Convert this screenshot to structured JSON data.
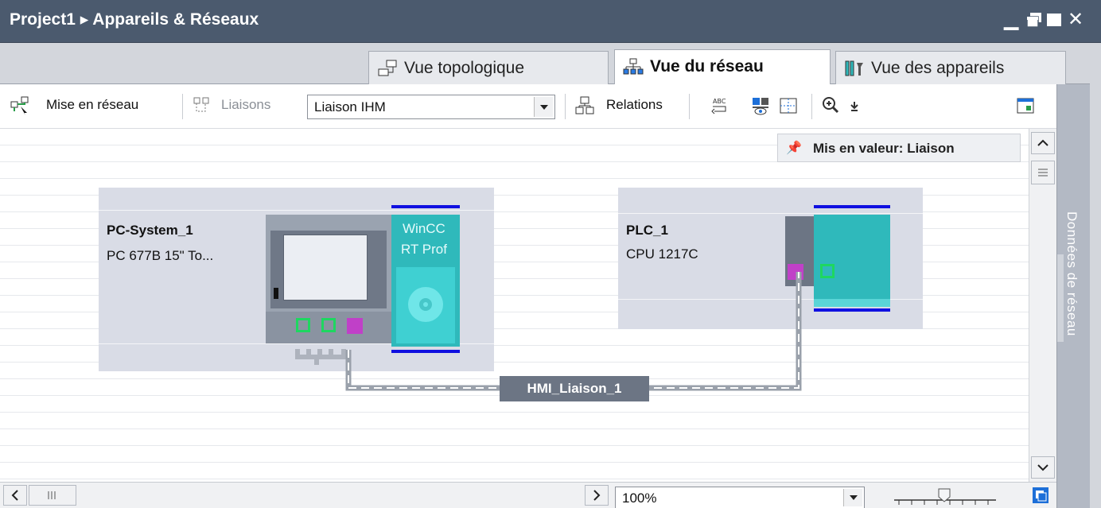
{
  "window": {
    "title": "Project1  ▸  Appareils & Réseaux",
    "controls": [
      "minimize-icon",
      "restore-icon",
      "maximize-icon",
      "close-icon"
    ]
  },
  "tabs": [
    {
      "label": "Vue topologique",
      "icon": "topology-icon",
      "active": false
    },
    {
      "label": "Vue du réseau",
      "icon": "network-icon",
      "active": true
    },
    {
      "label": "Vue des appareils",
      "icon": "devices-icon",
      "active": false
    }
  ],
  "toolbar": {
    "networking_label": "Mise en réseau",
    "connections_label": "Liaisons",
    "connection_type_value": "Liaison IHM",
    "relations_label": "Relations"
  },
  "tooltip": {
    "text": "Mis en valeur: Liaison"
  },
  "devices": [
    {
      "name": "PC-System_1",
      "type": "PC 677B 15\" To...",
      "module_label_1": "WinCC",
      "module_label_2": "RT Prof"
    },
    {
      "name": "PLC_1",
      "type": "CPU 1217C"
    }
  ],
  "connection": {
    "label": "HMI_Liaison_1"
  },
  "side_panel": {
    "label": "Données de réseau"
  },
  "zoom": {
    "value": "100%"
  },
  "colors": {
    "titlebar": "#4b5a6e",
    "device_bg": "#d9dce6",
    "cpu_teal": "#2fb9bb",
    "profinet_magenta": "#c040c8",
    "port_green": "#1ed760",
    "blue_rail": "#1010e0",
    "connection_label_bg": "#6c7584"
  }
}
